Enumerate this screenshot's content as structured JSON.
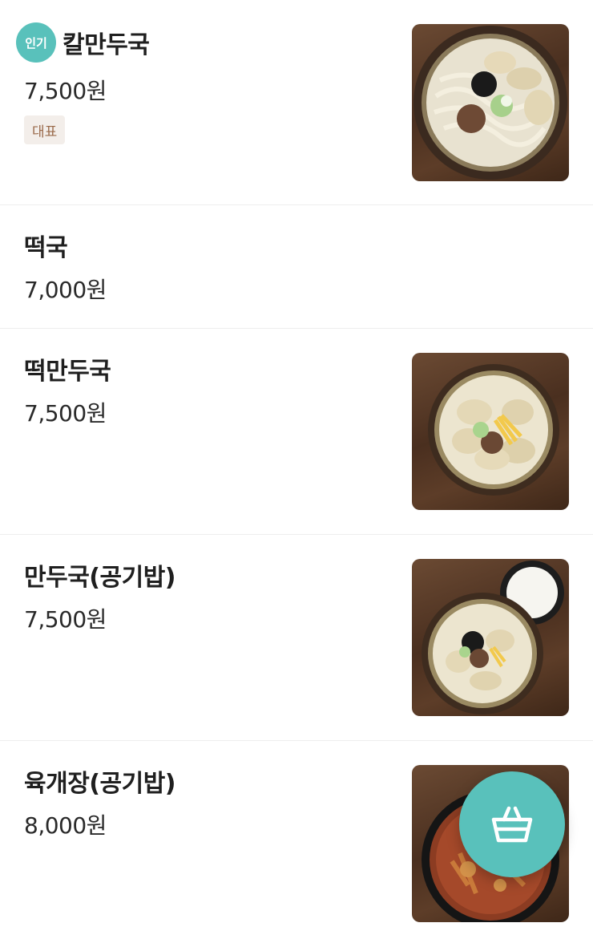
{
  "menu": {
    "items": [
      {
        "name": "칼만두국",
        "price": "7,500원",
        "popular_badge": "인기",
        "tag": "대표",
        "photo": "kalguksu-mandu-photo"
      },
      {
        "name": "떡국",
        "price": "7,000원"
      },
      {
        "name": "떡만두국",
        "price": "7,500원",
        "photo": "tteok-mandu-guk-photo"
      },
      {
        "name": "만두국(공기밥)",
        "price": "7,500원",
        "photo": "mandu-guk-rice-photo"
      },
      {
        "name": "육개장(공기밥)",
        "price": "8,000원",
        "photo": "yukgaejang-photo"
      }
    ]
  },
  "cart_button": {
    "icon": "basket-icon"
  },
  "colors": {
    "accent": "#59c1bb",
    "tag_bg": "#f3eeea",
    "tag_text": "#9a6a4a",
    "divider": "#eeeeee"
  }
}
